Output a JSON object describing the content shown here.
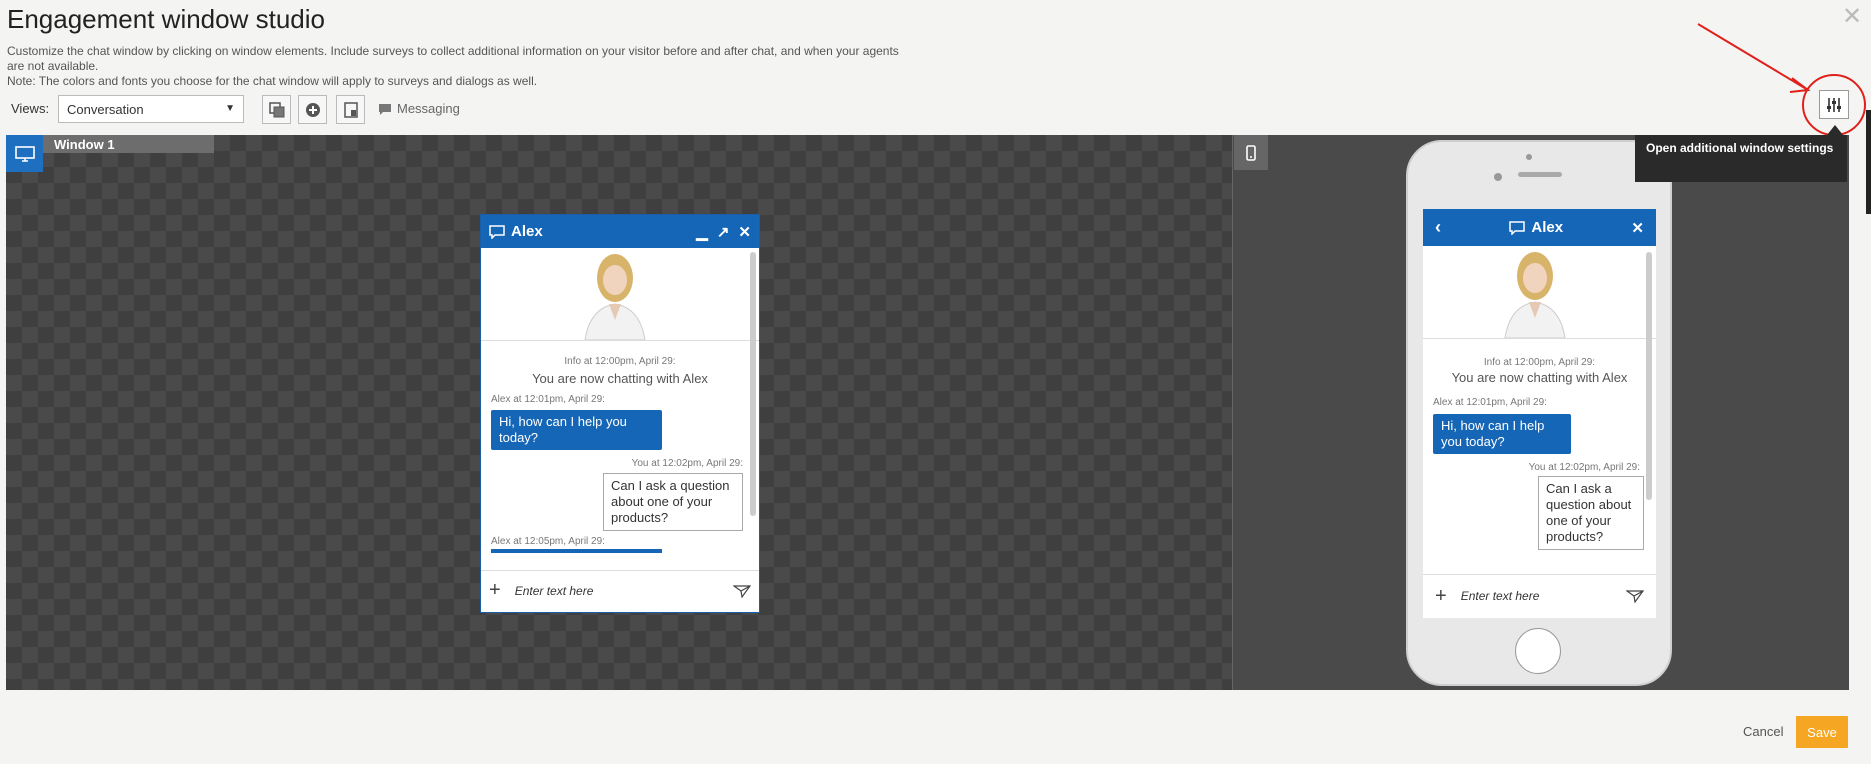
{
  "page": {
    "title": "Engagement window studio",
    "description_line1": "Customize the chat window by clicking on window elements. Include surveys to collect additional information on your visitor before and after chat, and when your agents",
    "description_line2": "are not available.",
    "description_line3": "Note: The colors and fonts you choose for the chat window will apply to surveys and dialogs as well."
  },
  "toolbar": {
    "views_label": "Views:",
    "views_selected": "Conversation",
    "messaging_label": "Messaging"
  },
  "stage": {
    "window_tab_label": "Window 1"
  },
  "chat": {
    "agent_name": "Alex",
    "info_line": "Info at 12:00pm, April 29:",
    "now_chatting": "You are now chatting with Alex",
    "msg1_meta": "Alex at 12:01pm, April 29:",
    "msg1_text": "Hi, how can I help you today?",
    "msg2_meta": "You at 12:02pm, April 29:",
    "msg2_text": "Can I ask a question about one of your products?",
    "msg3_meta": "Alex at 12:05pm, April 29:",
    "input_placeholder": "Enter text here"
  },
  "tooltip": {
    "text": "Open additional window settings"
  },
  "footer": {
    "cancel_label": "Cancel",
    "save_label": "Save"
  },
  "colors": {
    "brand_blue": "#1666b8",
    "save_orange": "#f5a623",
    "annotation_red": "#e0201b"
  }
}
